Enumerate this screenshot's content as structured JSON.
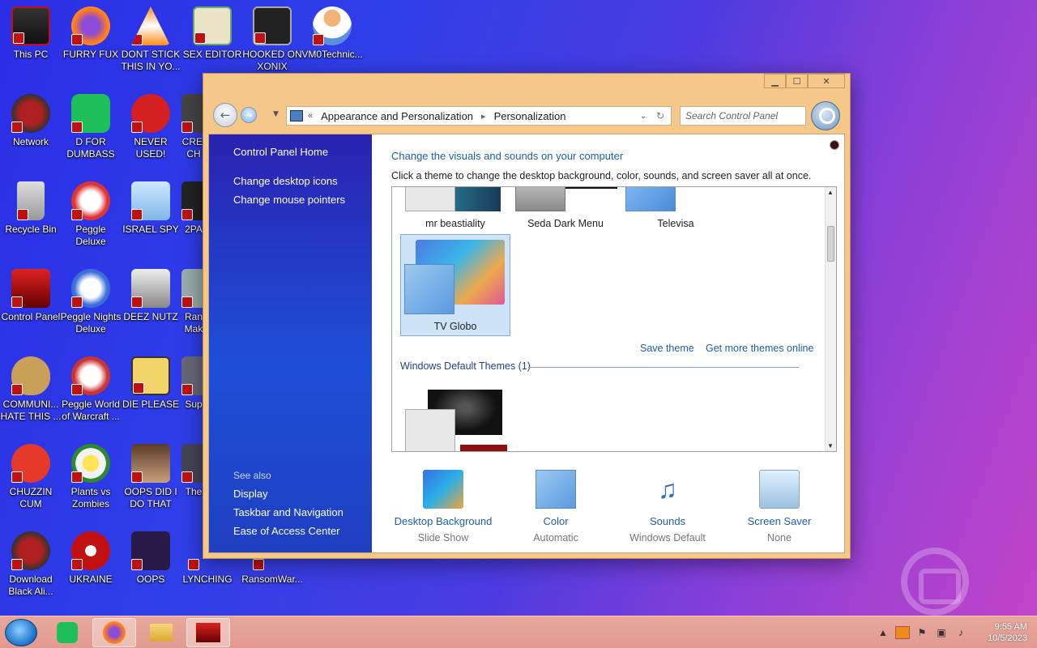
{
  "desktop": {
    "icons": [
      {
        "label": "This PC"
      },
      {
        "label": "FURRY FUX"
      },
      {
        "label": "DONT STICK THIS IN YO..."
      },
      {
        "label": "SEX EDITOR"
      },
      {
        "label": "HOOKED ON XONIX"
      },
      {
        "label": "VM0Technic..."
      },
      {
        "label": "Network"
      },
      {
        "label": "D FOR DUMBASS"
      },
      {
        "label": "NEVER USED!"
      },
      {
        "label": "CREI CH"
      },
      {
        "label": "Recycle Bin"
      },
      {
        "label": "Peggle Deluxe"
      },
      {
        "label": "ISRAEL SPY"
      },
      {
        "label": "2PA"
      },
      {
        "label": "Control Panel"
      },
      {
        "label": "Peggle Nights Deluxe"
      },
      {
        "label": "DEEZ NUTZ"
      },
      {
        "label": "Ran Mak"
      },
      {
        "label": "COMMUNI... HATE THIS ..."
      },
      {
        "label": "Peggle World of Warcraft ..."
      },
      {
        "label": "DIE PLEASE"
      },
      {
        "label": "Sup"
      },
      {
        "label": "CHUZZIN CUM"
      },
      {
        "label": "Plants vs Zombies"
      },
      {
        "label": "OOPS DID I DO THAT"
      },
      {
        "label": "The"
      },
      {
        "label": "Download Black Ali..."
      },
      {
        "label": "UKRAINE"
      },
      {
        "label": "OOPS"
      },
      {
        "label": "LYNCHING"
      },
      {
        "label": "RansomWar..."
      }
    ]
  },
  "window": {
    "nav": {
      "breadcrumb": [
        "Appearance and Personalization",
        "Personalization"
      ],
      "search_placeholder": "Search Control Panel"
    },
    "left_pane": {
      "home": "Control Panel Home",
      "links": [
        "Change desktop icons",
        "Change mouse pointers"
      ],
      "see_also_label": "See also",
      "see_also": [
        "Display",
        "Taskbar and Navigation",
        "Ease of Access Center"
      ]
    },
    "main": {
      "heading": "Change the visuals and sounds on your computer",
      "subheading": "Click a theme to change the desktop background, color, sounds, and screen saver all at once.",
      "themes": [
        {
          "name": "mr beastiality"
        },
        {
          "name": "Seda Dark Menu"
        },
        {
          "name": "Televisa"
        },
        {
          "name": "TV Globo",
          "selected": true
        }
      ],
      "save_theme": "Save theme",
      "get_more": "Get more themes online",
      "group_header": "Windows Default Themes (1)"
    },
    "bottom": [
      {
        "title": "Desktop Background",
        "value": "Slide Show"
      },
      {
        "title": "Color",
        "value": "Automatic"
      },
      {
        "title": "Sounds",
        "value": "Windows Default"
      },
      {
        "title": "Screen Saver",
        "value": "None"
      }
    ]
  },
  "taskbar": {
    "clock_time": "9:55 AM",
    "clock_date": "10/5/2023"
  },
  "colors": {
    "link": "#1f5ea8",
    "leftpane": "#1e4fd9",
    "frame": "#f5c88a",
    "taskbar": "#e19a90"
  }
}
